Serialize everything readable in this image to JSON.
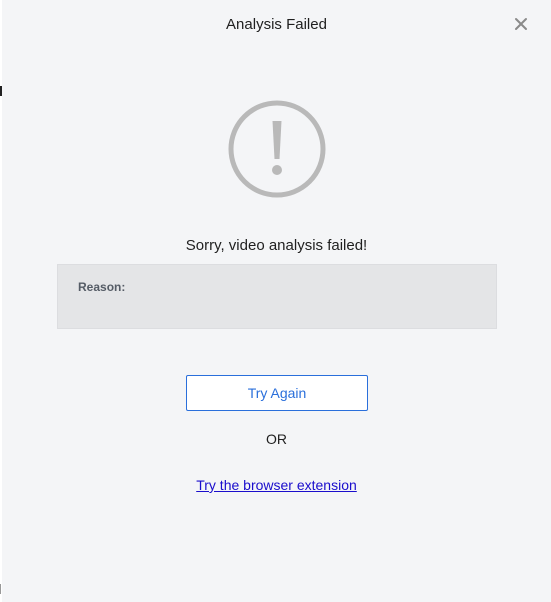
{
  "dialog": {
    "title": "Analysis Failed",
    "close_icon": "close-icon"
  },
  "status": {
    "icon": "warning-circle-icon",
    "icon_color": "#b9b9b9",
    "message": "Sorry, video analysis failed!"
  },
  "reason": {
    "label": "Reason:",
    "value": ""
  },
  "actions": {
    "try_again_label": "Try Again",
    "or_label": "OR",
    "extension_link_label": "Try the browser extension",
    "accent_color": "#2a6fdb",
    "link_color": "#1a0dcc"
  }
}
